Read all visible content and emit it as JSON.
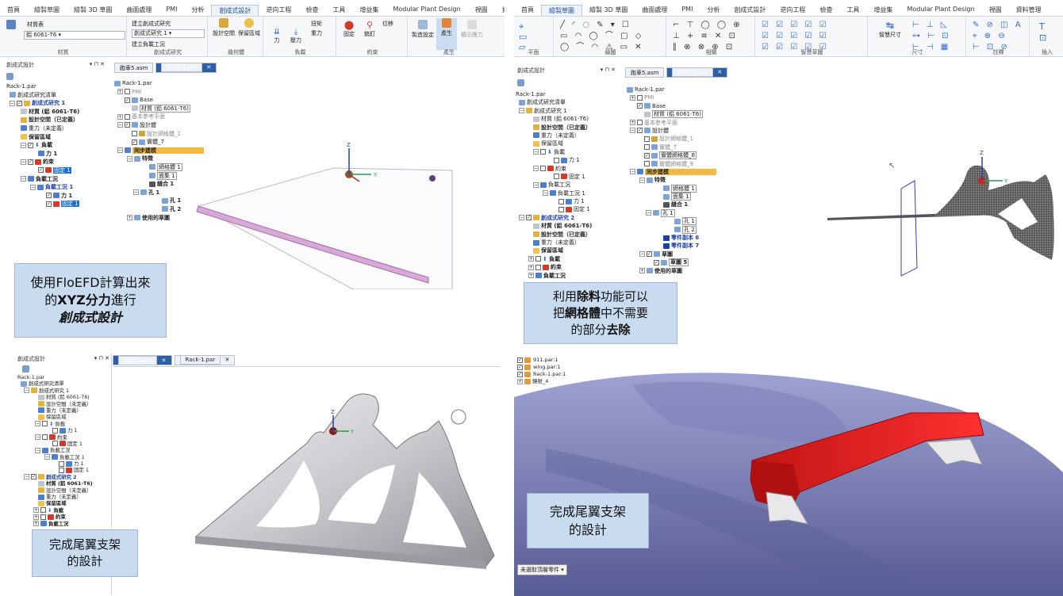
{
  "q1": {
    "menu_tabs": [
      "首頁",
      "繪製草圖",
      "繪製 3D 草圖",
      "曲面處理",
      "PMI",
      "分析",
      "創成式設計",
      "逆向工程",
      "檢查",
      "工具",
      "增益集",
      "Modular Plant Design",
      "視圖",
      "資料管理"
    ],
    "ribbon": {
      "material_label": "材質表",
      "material_value": "鋁 6061-T6",
      "material_group": "材質",
      "create_study": "建立創成式研究",
      "study_value": "創成式研究 1",
      "create_load_case": "建立負載工況",
      "study_group": "創成式研究",
      "design_space": "設計空間",
      "preserved_region": "保留區域",
      "geometry_group": "幾何體",
      "force": "力",
      "pressure": "壓力",
      "torque": "扭矩",
      "gravity": "重力",
      "load_group": "負載",
      "fixed": "固定",
      "pin": "銷釘",
      "displacement": "位移",
      "constraint_group": "約束",
      "manufacturing": "製造設定",
      "generate": "產生",
      "show_results": "顯示應力",
      "generate_group": "產生"
    },
    "panel_title": "創成式設計",
    "tree": [
      "Rack-1.par",
      "創成式研究清單",
      "創成式研究 1",
      "材質 (鋁 6061-T6)",
      "設計空間（已定義）",
      "重力（未定義）",
      "保留區域",
      "負載",
      "力 1",
      "約束",
      "固定 1",
      "負載工況",
      "負載工況 1",
      "力 1",
      "固定 1"
    ],
    "doc_tabs": [
      "跑車5.asm",
      "Rack-1.par"
    ],
    "model_tree": [
      "Rack-1.par",
      "PMI",
      "Base",
      "材質 (鋁 6061-T6)",
      "基本參考平面",
      "設計體",
      "設計網格體_1",
      "實體_7",
      "同步建模",
      "特徵",
      "網格體 1",
      "面集 1",
      "縫合 1",
      "孔 1",
      "孔 1",
      "孔 2",
      "使用的草圖"
    ],
    "callout_line1": "使用FloEFD計算出來",
    "callout_line2a": "的",
    "callout_line2b": "XYZ分力",
    "callout_line2c": "進行",
    "callout_line3": "創成式設計"
  },
  "q2": {
    "menu_tabs": [
      "首頁",
      "繪製草圖",
      "繪製 3D 草圖",
      "曲面處理",
      "PMI",
      "分析",
      "創成式設計",
      "逆向工程",
      "檢查",
      "工具",
      "增益集",
      "Modular Plant Design",
      "視圖",
      "資料管理"
    ],
    "ribbon_groups": [
      "平面",
      "繪圖",
      "相關",
      "智慧草圖",
      "尺寸",
      "註釋",
      "插入"
    ],
    "smart_dim": "智慧尺寸",
    "panel_title": "創成式設計",
    "tree": [
      "Rack-1.par",
      "創成式研究清單",
      "創成式研究 1",
      "材質 (鋁 6061-T6)",
      "設計空間（已定義）",
      "重力（未定義）",
      "保留區域",
      "負載",
      "力 1",
      "約束",
      "固定 1",
      "負載工況",
      "負載工況 1",
      "力 1",
      "固定 1",
      "創成式研究 2",
      "材質 (鋁 6061-T6)",
      "設計空間（已定義）",
      "重力（未定義）",
      "保留區域",
      "負載",
      "約束",
      "負載工況"
    ],
    "doc_tabs": [
      "跑車5.asm",
      "Rack-1.par"
    ],
    "model_tree": [
      "Rack-1.par",
      "PMI",
      "Base",
      "材質 (鋁 6061-T6)",
      "基本參考平面",
      "設計體",
      "設計網格體_1",
      "實體_7",
      "實體網格體_8",
      "實體網格體_9",
      "同步建模",
      "特徵",
      "網格體 1",
      "面集 1",
      "縫合 1",
      "孔 1",
      "孔 1",
      "孔 2",
      "零件副本 6",
      "零件副本 7",
      "草圖",
      "草圖 5",
      "使用的草圖"
    ],
    "callout_line1a": "利用",
    "callout_line1b": "除料",
    "callout_line1c": "功能可以",
    "callout_line2a": "把",
    "callout_line2b": "網格體",
    "callout_line2c": "中不需要",
    "callout_line3a": "的部分",
    "callout_line3b": "去除"
  },
  "q3": {
    "panel_title": "創成式設計",
    "doc_tabs": [
      "跑車5.asm",
      "Rack-1.par"
    ],
    "tree": [
      "Rack-1.par",
      "創成式研究清單",
      "創成式研究 1",
      "材質 (鋁 6061-T6)",
      "設計空間（未定義）",
      "重力（未定義）",
      "保留區域",
      "負載",
      "力 1",
      "約束",
      "固定 1",
      "負載工況",
      "負載工況 1",
      "力 1",
      "固定 1",
      "創成式研究 2",
      "材質 (鋁 6061-T6)",
      "設計空間（未定義）",
      "重力（未定義）",
      "保留區域",
      "負載",
      "約束",
      "負載工況"
    ],
    "callout_line1": "完成尾翼支架",
    "callout_line2": "的設計"
  },
  "q4": {
    "tree": [
      "911.par:1",
      "wing.par:1",
      "Rack-1.par:1",
      "鏡射_4"
    ],
    "status": "未選取頂層零件",
    "callout_line1": "完成尾翼支架",
    "callout_line2": "的設計"
  },
  "colors": {
    "accent": "#2c5fa8",
    "callout_bg": "#c9dbef",
    "sync": "#f4b942",
    "wing": "#e01f1f",
    "car": "#6b6fa8"
  }
}
